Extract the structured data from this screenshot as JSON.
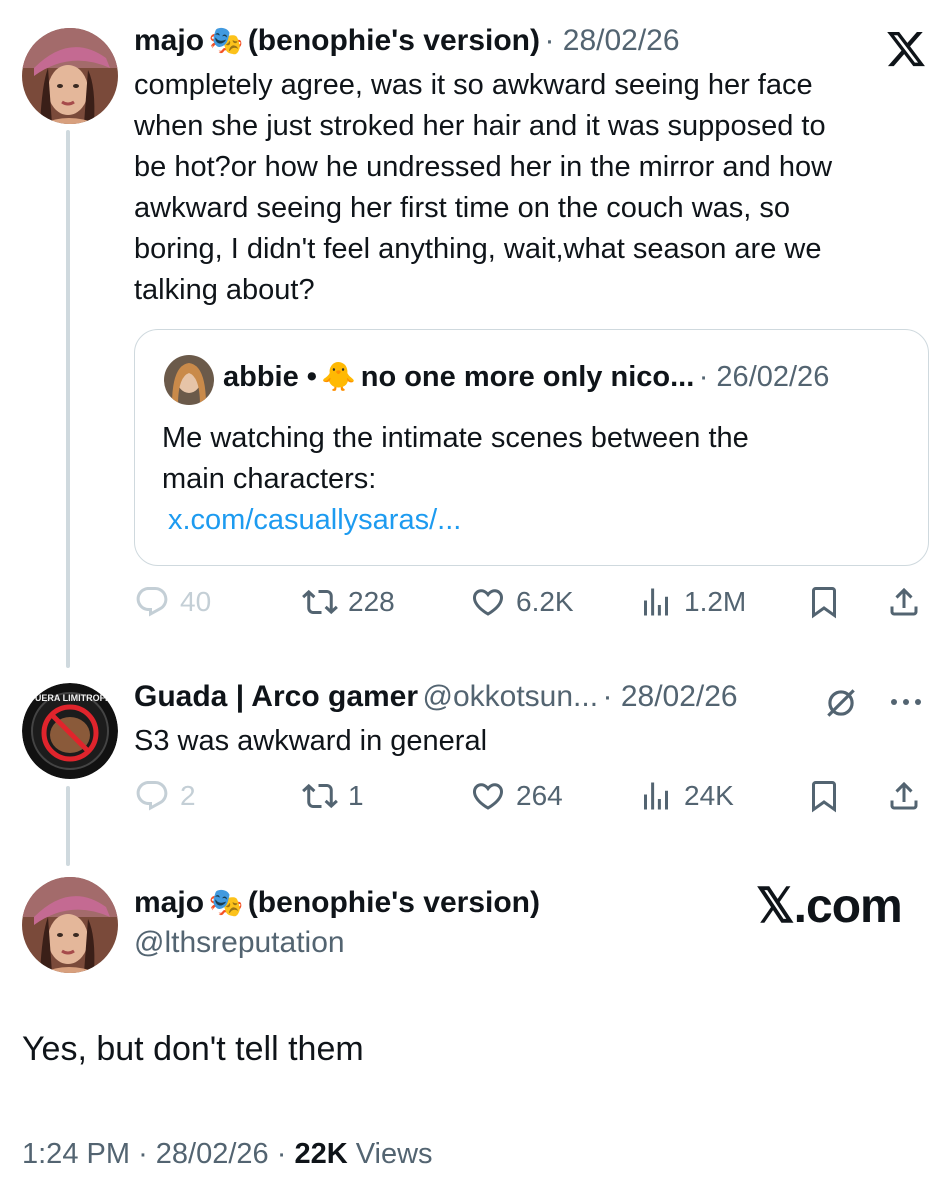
{
  "tweet1": {
    "name": "majo",
    "emoji": "🎭",
    "name_suffix": "(benophie's version)",
    "date": "· 28/02/26",
    "text_lines": [
      "completely agree, was it so awkward seeing her face",
      "when she just stroked her hair and it was supposed to",
      "be hot?or how he undressed her in the mirror and how",
      "awkward seeing her first time on the couch was, so",
      "boring, I didn't feel anything, wait,what season are we",
      "talking about?"
    ],
    "quote": {
      "name": "abbie •",
      "emoji": "🐥",
      "name_rest": "no one more only nico...",
      "date": "· 26/02/26",
      "text_lines": [
        "Me watching the intimate scenes between the",
        "main characters:"
      ],
      "link": "x.com/casuallysaras/..."
    },
    "stats": {
      "replies": "40",
      "reposts": "228",
      "likes": "6.2K",
      "views": "1.2M"
    }
  },
  "tweet2": {
    "name": "Guada | Arco gamer",
    "handle": "@okkotsun...",
    "date": "· 28/02/26",
    "text": "S3 was awkward in general",
    "stats": {
      "replies": "2",
      "reposts": "1",
      "likes": "264",
      "views": "24K"
    }
  },
  "tweet3": {
    "name": "majo",
    "emoji": "🎭",
    "name_suffix": "(benophie's version)",
    "handle": "@lthsreputation",
    "text": "Yes, but don't tell them",
    "time": "1:24 PM",
    "date": "· 28/02/26 ·",
    "views_count": "22K",
    "views_label": "Views"
  },
  "brand": {
    "logo": "𝕏",
    "watermark": "𝕏.com"
  },
  "icons": [
    "x-logo-icon",
    "reply-icon",
    "repost-icon",
    "like-icon",
    "views-icon",
    "bookmark-icon",
    "share-icon",
    "grok-icon",
    "more-icon"
  ]
}
